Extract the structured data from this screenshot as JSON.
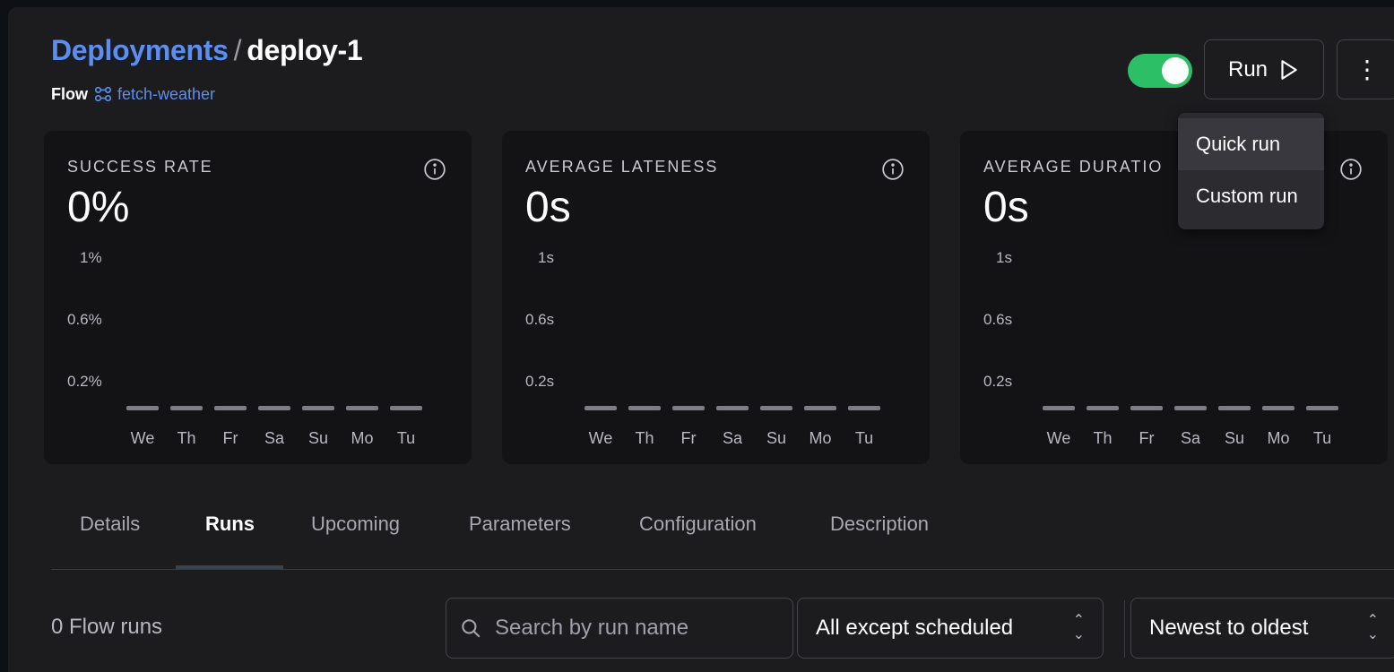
{
  "header": {
    "breadcrumb_parent": "Deployments",
    "breadcrumb_separator": "/",
    "breadcrumb_current": "deploy-1",
    "flow_label": "Flow",
    "flow_name": "fetch-weather"
  },
  "controls": {
    "toggle_on": true,
    "run_label": "Run",
    "menu_label": "⋮"
  },
  "run_dropdown": {
    "items": [
      "Quick run",
      "Custom run"
    ]
  },
  "cards": [
    {
      "title": "SUCCESS RATE",
      "value": "0%",
      "yticks": [
        "1%",
        "0.6%",
        "0.2%"
      ]
    },
    {
      "title": "AVERAGE LATENESS",
      "value": "0s",
      "yticks": [
        "1s",
        "0.6s",
        "0.2s"
      ]
    },
    {
      "title": "AVERAGE DURATIO",
      "value": "0s",
      "yticks": [
        "1s",
        "0.6s",
        "0.2s"
      ]
    }
  ],
  "days": [
    "We",
    "Th",
    "Fr",
    "Sa",
    "Su",
    "Mo",
    "Tu"
  ],
  "tabs": [
    "Details",
    "Runs",
    "Upcoming",
    "Parameters",
    "Configuration",
    "Description"
  ],
  "active_tab": "Runs",
  "runs": {
    "count_label": "0 Flow runs",
    "search_placeholder": "Search by run name",
    "state_filter": "All except scheduled",
    "sort": "Newest to oldest"
  },
  "colors": {
    "accent_blue": "#5b8ef0",
    "toggle_green": "#2dbf66",
    "background": "#1c1c1f",
    "card": "#131316"
  }
}
